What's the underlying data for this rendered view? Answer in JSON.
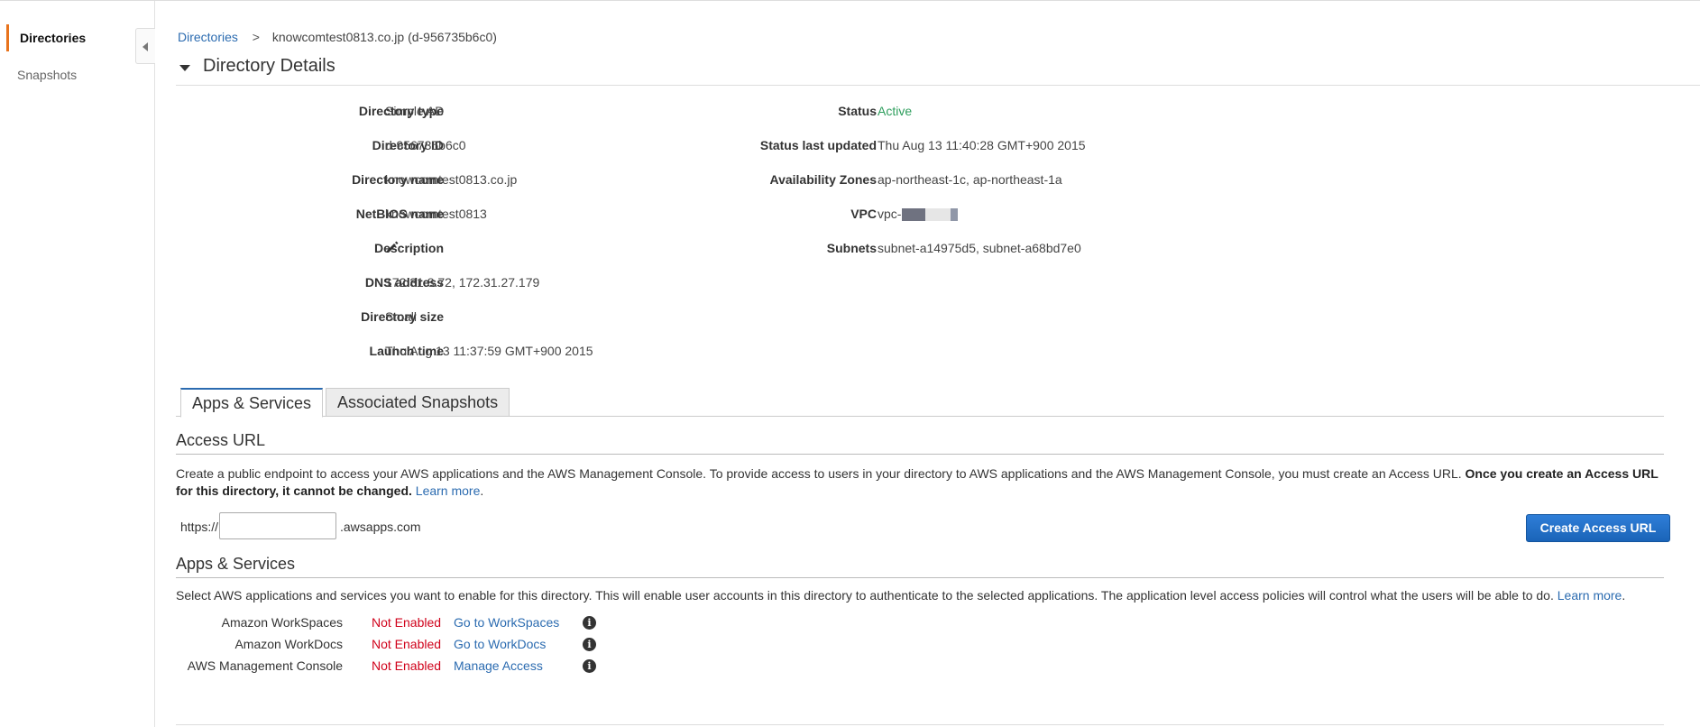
{
  "sidebar": {
    "items": [
      {
        "label": "Directories",
        "active": true
      },
      {
        "label": "Snapshots",
        "active": false
      }
    ]
  },
  "breadcrumb": {
    "root": "Directories",
    "separator": ">",
    "current": "knowcomtest0813.co.jp (d-956735b6c0)"
  },
  "section": {
    "title": "Directory Details"
  },
  "details_left": [
    {
      "label": "Directory type",
      "value": "Simple AD"
    },
    {
      "label": "Directory ID",
      "value": "d-956735b6c0"
    },
    {
      "label": "Directory name",
      "value": "knowcomtest0813.co.jp"
    },
    {
      "label": "NetBIOS name",
      "value": "knowcomtest0813"
    },
    {
      "label": "Description",
      "value": "",
      "icon": "pencil-icon"
    },
    {
      "label": "DNS address",
      "value": "172.31.8.72, 172.31.27.179"
    },
    {
      "label": "Directory size",
      "value": "Small"
    },
    {
      "label": "Launch time",
      "value": "Thu Aug 13 11:37:59 GMT+900 2015"
    }
  ],
  "details_right": [
    {
      "label": "Status",
      "value": "Active"
    },
    {
      "label": "Status last updated",
      "value": "Thu Aug 13 11:40:28 GMT+900 2015"
    },
    {
      "label": "Availability Zones",
      "value": "ap-northeast-1c, ap-northeast-1a"
    },
    {
      "label": "VPC",
      "value": "vpc-"
    },
    {
      "label": "Subnets",
      "value": "subnet-a14975d5, subnet-a68bd7e0"
    }
  ],
  "tabs": [
    {
      "label": "Apps & Services",
      "active": true
    },
    {
      "label": "Associated Snapshots",
      "active": false
    }
  ],
  "access_url": {
    "heading": "Access URL",
    "description": "Create a public endpoint to access your AWS applications and the AWS Management Console. To provide access to users in your directory to AWS applications and the AWS Management Console, you must create an Access URL.",
    "warning": "Once you create an Access URL for this directory, it cannot be changed.",
    "learn_more": "Learn more",
    "prefix": "https://",
    "input_value": "",
    "suffix": ".awsapps.com",
    "create_button": "Create Access URL"
  },
  "apps_services": {
    "heading": "Apps & Services",
    "description": "Select AWS applications and services you want to enable for this directory. This will enable user accounts in this directory to authenticate to the selected applications. The application level access policies will control what the users will be able to do.",
    "learn_more": "Learn more",
    "apps": [
      {
        "name": "Amazon WorkSpaces",
        "status": "Not Enabled",
        "link": "Go to WorkSpaces"
      },
      {
        "name": "Amazon WorkDocs",
        "status": "Not Enabled",
        "link": "Go to WorkDocs"
      },
      {
        "name": "AWS Management Console",
        "status": "Not Enabled",
        "link": "Manage Access"
      }
    ],
    "info_icon": "i"
  },
  "colors": {
    "accent": "#e8731c",
    "link": "#2b6bb0",
    "active_status": "#2e9e5d",
    "not_enabled": "#d0021b",
    "primary_button": "#1a64b8"
  }
}
